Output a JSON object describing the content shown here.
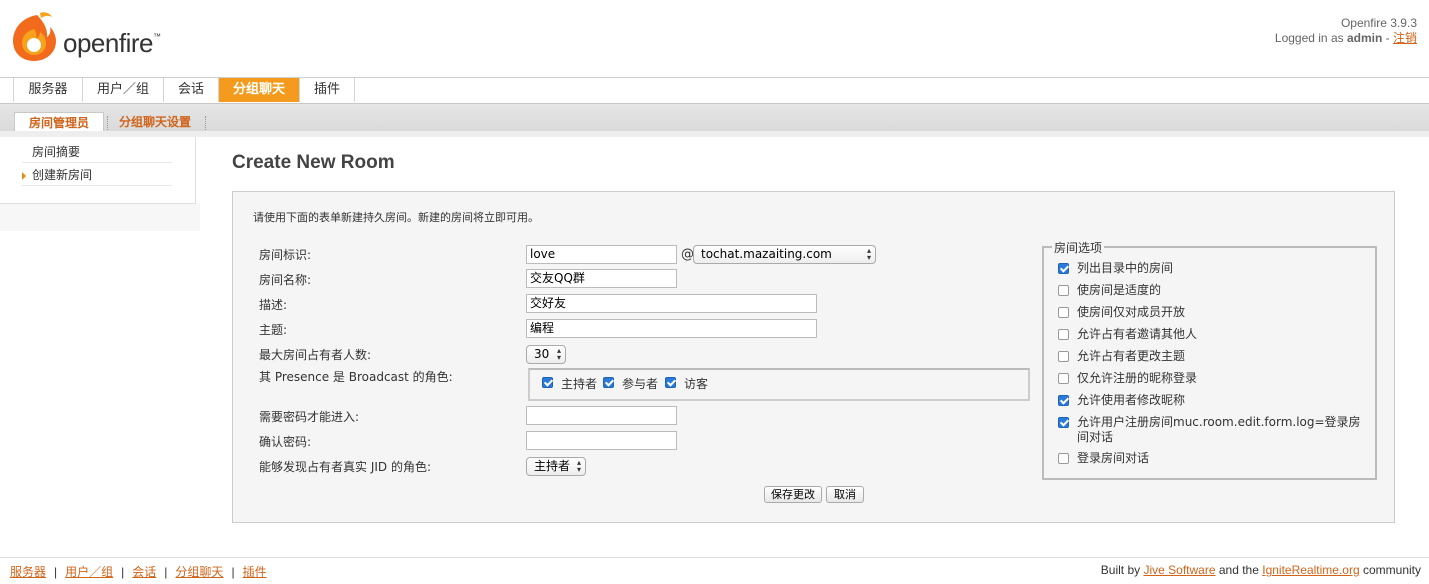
{
  "app": {
    "logo_text": "openfire",
    "version": "Openfire 3.9.3",
    "logged_in_prefix": "Logged in as",
    "user": "admin",
    "logout": "注销"
  },
  "main_tabs": [
    "服务器",
    "用户／组",
    "会话",
    "分组聊天",
    "插件"
  ],
  "active_tab": "分组聊天",
  "sub_tabs": [
    "房间管理员",
    "分组聊天设置"
  ],
  "sidebar": {
    "items": [
      "房间摘要",
      "创建新房间"
    ],
    "active": "创建新房间"
  },
  "page": {
    "title": "Create New Room",
    "intro": "请使用下面的表单新建持久房间。新建的房间将立即可用。"
  },
  "form": {
    "room_id_label": "房间标识:",
    "room_id_value": "love",
    "at_sign": "@",
    "domain_value": "tochat.mazaiting.com",
    "room_name_label": "房间名称:",
    "room_name_value": "交友QQ群",
    "description_label": "描述:",
    "description_value": "交好友",
    "subject_label": "主题:",
    "subject_value": "编程",
    "max_occupants_label": "最大房间占有者人数:",
    "max_occupants_value": "30",
    "broadcast_label": "其 Presence 是 Broadcast 的角色:",
    "broadcast_roles": [
      {
        "label": "主持者",
        "checked": true
      },
      {
        "label": "参与者",
        "checked": true
      },
      {
        "label": "访客",
        "checked": true
      }
    ],
    "password_label": "需要密码才能进入:",
    "password_value": "",
    "confirm_password_label": "确认密码:",
    "confirm_password_value": "",
    "jid_label": "能够发现占有者真实 JID 的角色:",
    "jid_value": "主持者",
    "save_button": "保存更改",
    "cancel_button": "取消"
  },
  "room_options": {
    "legend": "房间选项",
    "items": [
      {
        "label": "列出目录中的房间",
        "checked": true
      },
      {
        "label": "使房间是适度的",
        "checked": false
      },
      {
        "label": "使房间仅对成员开放",
        "checked": false
      },
      {
        "label": "允许占有者邀请其他人",
        "checked": false
      },
      {
        "label": "允许占有者更改主题",
        "checked": false
      },
      {
        "label": "仅允许注册的昵称登录",
        "checked": false
      },
      {
        "label": "允许使用者修改昵称",
        "checked": true
      },
      {
        "label": "允许用户注册房间muc.room.edit.form.log=登录房间对话",
        "checked": true
      },
      {
        "label": "登录房间对话",
        "checked": false
      }
    ]
  },
  "footer": {
    "links": [
      "服务器",
      "用户／组",
      "会话",
      "分组聊天",
      "插件"
    ],
    "built_by": "Built by",
    "jive": "Jive Software",
    "and_the": "and the",
    "ignite": "IgniteRealtime.org",
    "community": "community"
  },
  "colors": {
    "accent": "#f49b1d",
    "link": "#d0641a",
    "checkbox": "#2a7ad9"
  }
}
